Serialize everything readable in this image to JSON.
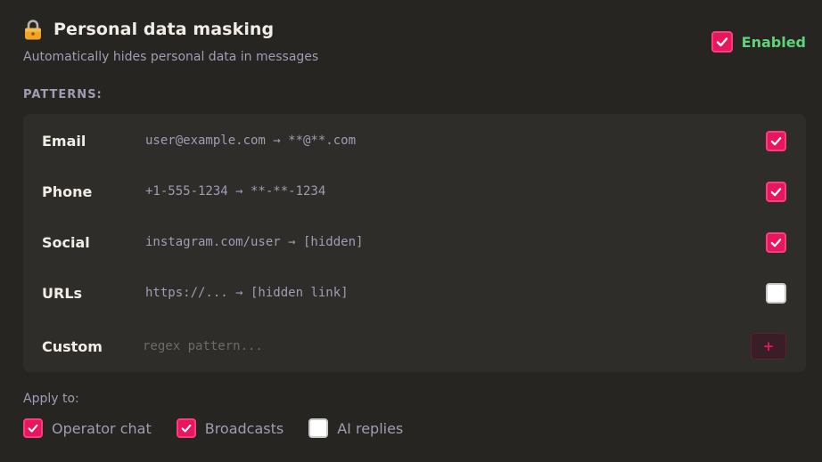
{
  "header": {
    "title": "Personal data masking",
    "subtitle": "Automatically hides personal data in messages",
    "enabled_label": "Enabled",
    "enabled": true
  },
  "patterns": {
    "label": "PATTERNS:",
    "items": [
      {
        "label": "Email",
        "example": "user@example.com → **@**.com",
        "checked": true
      },
      {
        "label": "Phone",
        "example": "+1-555-1234 → **-**-1234",
        "checked": true
      },
      {
        "label": "Social",
        "example": "instagram.com/user → [hidden]",
        "checked": true
      },
      {
        "label": "URLs",
        "example": "https://... → [hidden link]",
        "checked": false
      }
    ],
    "custom": {
      "label": "Custom",
      "placeholder": "regex pattern...",
      "value": "",
      "add_label": "+"
    }
  },
  "apply_to": {
    "label": "Apply to:",
    "items": [
      {
        "label": "Operator chat",
        "checked": true
      },
      {
        "label": "Broadcasts",
        "checked": true
      },
      {
        "label": "AI replies",
        "checked": false
      }
    ]
  },
  "colors": {
    "background": "#272522",
    "panel": "#2f2d2a",
    "accent": "#e8165f",
    "enabled_green": "#5fd27a",
    "muted_text": "#a39bb2"
  },
  "icons": {
    "title_icon": "lock-icon",
    "check": "checkmark-icon"
  }
}
